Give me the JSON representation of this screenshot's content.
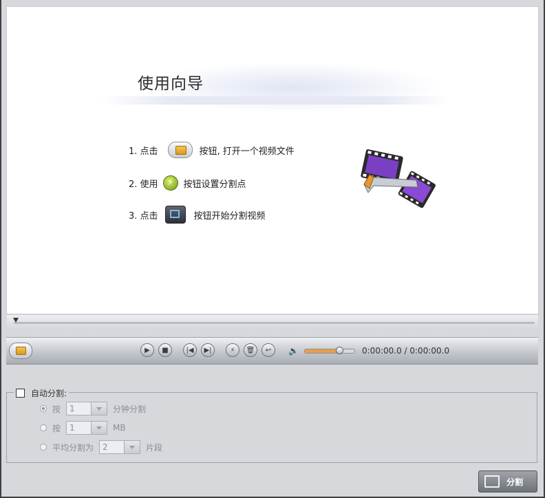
{
  "guide": {
    "title": "使用向导",
    "steps": [
      {
        "pre": "1. 点击",
        "post": "按钮, 打开一个视频文件"
      },
      {
        "pre": "2. 使用",
        "post": "按钮设置分割点"
      },
      {
        "pre": "3. 点击",
        "post": "按钮开始分割视频"
      }
    ]
  },
  "player": {
    "time": "0:00:00.0 / 0:00:00.0",
    "volume_level": 0.65,
    "buttons": [
      {
        "name": "play-button",
        "glyph": "▶"
      },
      {
        "name": "stop-button",
        "glyph": "■"
      },
      {
        "name": "prev-button",
        "glyph": "|◀"
      },
      {
        "name": "next-button",
        "glyph": "▶|"
      },
      {
        "name": "split-point-button",
        "glyph": "⚡"
      },
      {
        "name": "delete-button",
        "glyph": "🗑"
      },
      {
        "name": "undo-button",
        "glyph": "↩"
      }
    ],
    "volume_icon": "🔉"
  },
  "auto_split": {
    "label": "自动分割:",
    "options": [
      {
        "prefix": "按",
        "value": "1",
        "suffix": "分钟分割",
        "selected": true
      },
      {
        "prefix": "按",
        "value": "1",
        "suffix": "MB",
        "selected": false
      },
      {
        "prefix": "平均分割为",
        "value": "2",
        "suffix": "片段",
        "selected": false
      }
    ]
  },
  "split_button": {
    "label": "分割"
  }
}
